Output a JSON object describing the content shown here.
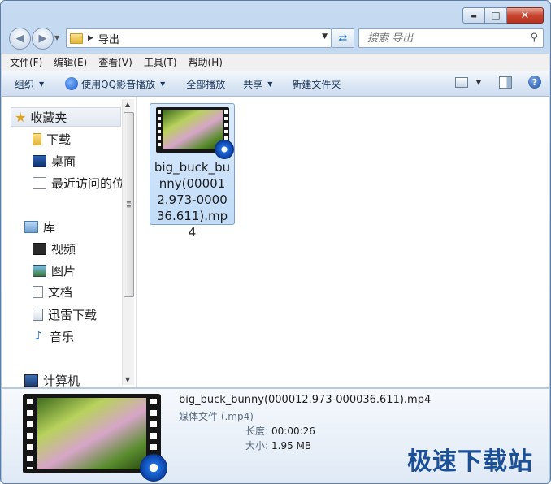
{
  "window": {
    "caption_buttons": {
      "minimize": "▬",
      "maximize": "□",
      "close": "✕"
    }
  },
  "address": {
    "path": "导出",
    "search_placeholder": "搜索 导出"
  },
  "menu": [
    "文件(F)",
    "编辑(E)",
    "查看(V)",
    "工具(T)",
    "帮助(H)"
  ],
  "toolbar": {
    "organize": "组织",
    "play_with": "使用QQ影音播放",
    "play_all": "全部播放",
    "share": "共享",
    "new_folder": "新建文件夹"
  },
  "nav": {
    "favorites": "收藏夹",
    "downloads": "下载",
    "desktop": "桌面",
    "recent": "最近访问的位",
    "libraries": "库",
    "videos": "视频",
    "pictures": "图片",
    "documents": "文档",
    "xunlei": "迅雷下载",
    "music": "音乐",
    "computer": "计算机"
  },
  "file": {
    "name": "big_buck_bunny(000012.973-000036.611).mp4"
  },
  "details": {
    "name": "big_buck_bunny(000012.973-000036.611).mp4",
    "type": "媒体文件 (.mp4)",
    "length_label": "长度:",
    "length": "00:00:26",
    "size_label": "大小:",
    "size": "1.95 MB"
  },
  "watermark": "极速下载站"
}
